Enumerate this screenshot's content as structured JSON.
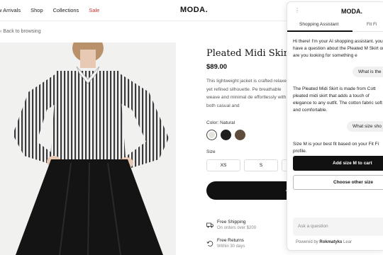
{
  "nav": {
    "links": [
      "w Arrivals",
      "Shop",
      "Collections",
      "Sale"
    ],
    "logo": "MODA."
  },
  "back_link": "Back to browsing",
  "product": {
    "title": "Pleated Midi Skirt",
    "price": "$89.00",
    "description": "This lightweight jacket is crafted relaxed yet refined silhouette. Pe breathable weave and minimal de effortlessly with both casual and",
    "color_label": "Color: Natural",
    "swatches": [
      "#e6e3dd",
      "#1f1f1f",
      "#5e4c3c"
    ],
    "size_label": "Size",
    "sizes": [
      "XS",
      "S",
      ""
    ],
    "add_to_cart": "A",
    "features": [
      {
        "title": "Free Shipping",
        "sub": "On orders over $200"
      },
      {
        "title": "Free Returns",
        "sub": "Within 30 days"
      }
    ]
  },
  "assistant": {
    "menu_icon": "kebab-icon",
    "logo": "MODA.",
    "tabs": [
      "Shopping Assistant",
      "Fit Fi"
    ],
    "greeting": "Hi there! I'm your AI shopping assistant. you have a question about the Pleated M Skirt or are you looking for something e",
    "user_q1": "What is the",
    "answer1": "The Pleated Midi Skirt is made from Cott pleated midi skirt that adds a touch of elegance to any outfit. The cotton fabric soft and comfortable.",
    "user_q2": "What size sho",
    "answer2": "Size M is your best fit based on your Fit Fi profile.",
    "primary_button": "Add size M to cart",
    "secondary_button": "Choose other size",
    "input_placeholder": "Ask a question",
    "powered_prefix": "Powered by",
    "powered_brand": "Rokmatyks",
    "powered_suffix": "Lear"
  }
}
